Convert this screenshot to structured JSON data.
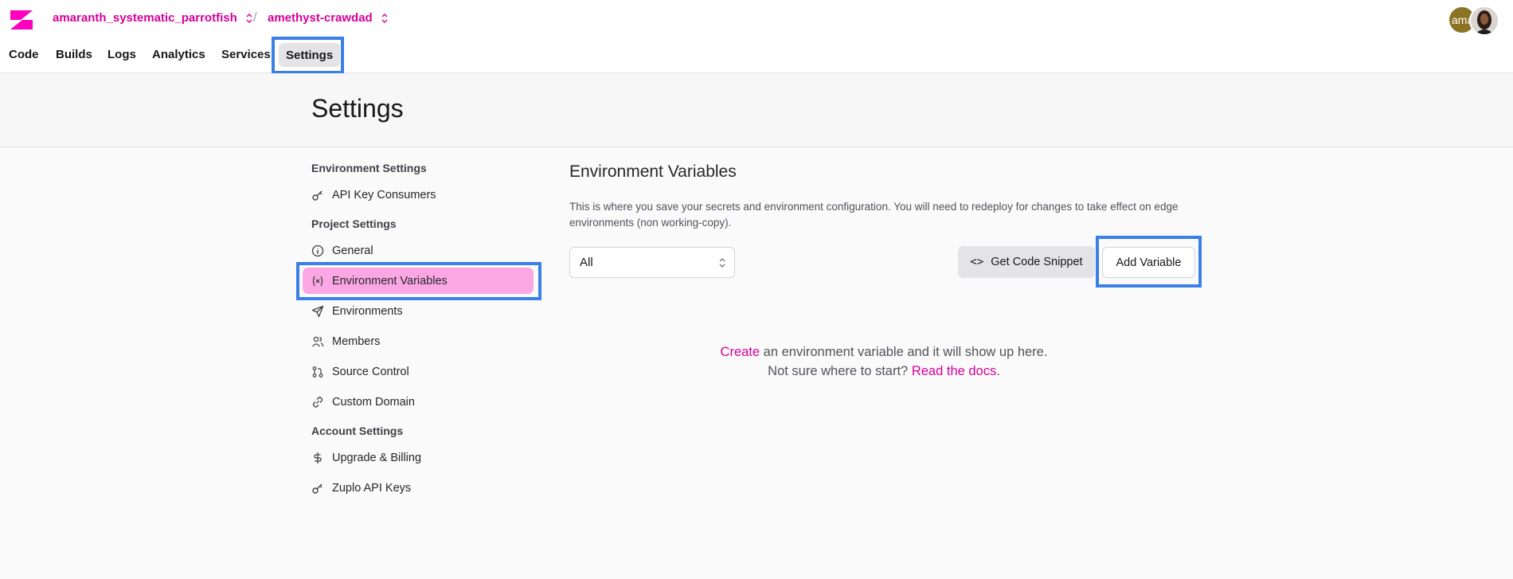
{
  "header": {
    "project_name": "amaranth_systematic_parrotfish",
    "separator": "/",
    "environment_name": "amethyst-crawdad",
    "avatar_text": "ama",
    "colors": {
      "brand": "#d6009a",
      "highlight": "#3b7fe8"
    }
  },
  "tabs": [
    {
      "label": "Code"
    },
    {
      "label": "Builds"
    },
    {
      "label": "Logs"
    },
    {
      "label": "Analytics"
    },
    {
      "label": "Services"
    },
    {
      "label": "Settings",
      "active": true
    }
  ],
  "page": {
    "title": "Settings"
  },
  "sidebar": {
    "sections": [
      {
        "heading": "Environment Settings"
      },
      {
        "heading": "Project Settings"
      },
      {
        "heading": "Account Settings"
      }
    ],
    "items": [
      {
        "label": "API Key Consumers",
        "icon": "key-icon"
      },
      {
        "label": "General",
        "icon": "info-icon"
      },
      {
        "label": "Environment Variables",
        "icon": "variable-icon",
        "active": true
      },
      {
        "label": "Environments",
        "icon": "send-icon"
      },
      {
        "label": "Members",
        "icon": "users-icon"
      },
      {
        "label": "Source Control",
        "icon": "git-pull-request-icon"
      },
      {
        "label": "Custom Domain",
        "icon": "link-icon"
      },
      {
        "label": "Upgrade & Billing",
        "icon": "dollar-icon"
      },
      {
        "label": "Zuplo API Keys",
        "icon": "key-icon"
      }
    ]
  },
  "main": {
    "title": "Environment Variables",
    "description": "This is where you save your secrets and environment configuration. You will need to redeploy for changes to take effect on edge environments (non working-copy).",
    "filter": {
      "selected": "All"
    },
    "buttons": {
      "snippet": "Get Code Snippet",
      "add": "Add Variable"
    },
    "empty_state": {
      "create_link": "Create",
      "line1_rest": " an environment variable and it will show up here.",
      "line2_prefix": "Not sure where to start? ",
      "docs_link": "Read the docs",
      "line2_suffix": "."
    }
  }
}
